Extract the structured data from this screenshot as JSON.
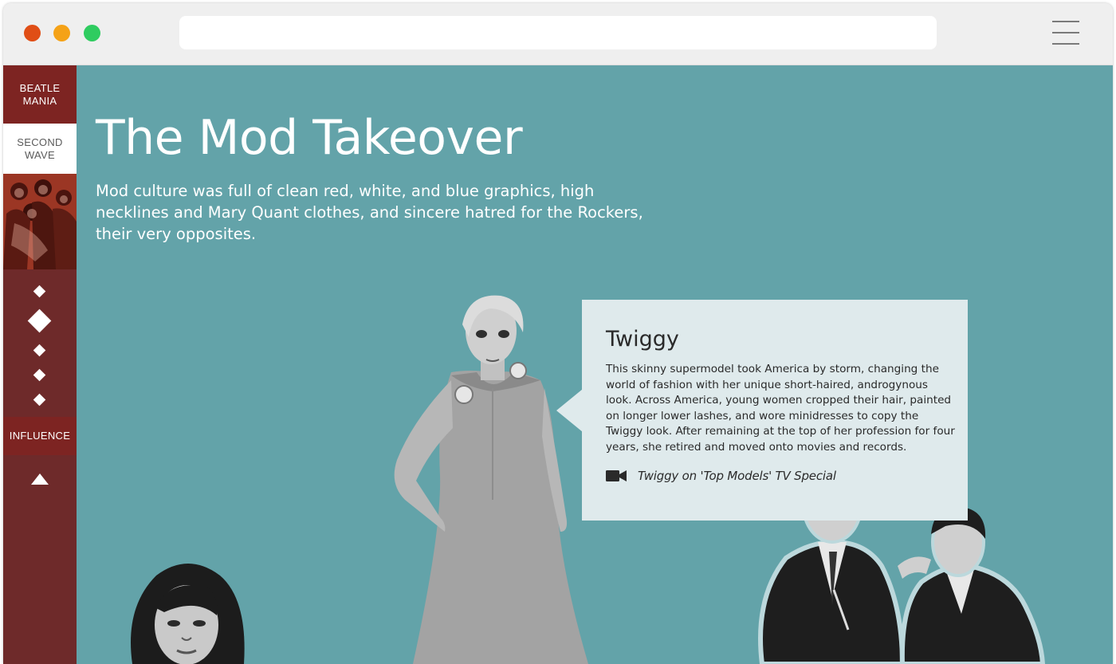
{
  "browser": {
    "address_value": ""
  },
  "sidebar": {
    "items": [
      {
        "label": "BEATLE\nMANIA"
      },
      {
        "label": "SECOND\nWAVE"
      },
      {
        "label": "INFLUENCE"
      }
    ],
    "thumbnail_icon": "band-photo-thumbnail",
    "up_icon": "up-arrow-icon"
  },
  "main": {
    "title": "The Mod Takeover",
    "subtitle": "Mod culture was full of clean red, white, and blue graphics, high necklines and Mary Quant clothes, and sincere hatred for the Rockers, their very opposites."
  },
  "card": {
    "title": "Twiggy",
    "body": "This skinny supermodel took America by storm, changing the world of fashion with her unique short-haired, androgynous look. Across America, young women cropped their hair, painted on longer lower lashes, and wore minidresses to copy the Twiggy look. After remaining at the top of her profession for four years, she retired and moved onto movies and records.",
    "video_label": "Twiggy on 'Top Models' TV Special",
    "video_icon": "video-camera-icon"
  },
  "colors": {
    "sidebar": "#6e2a2a",
    "sidebar_active": "#7d2422",
    "main_bg": "#63a3a9",
    "card_bg": "#dfeaec"
  }
}
